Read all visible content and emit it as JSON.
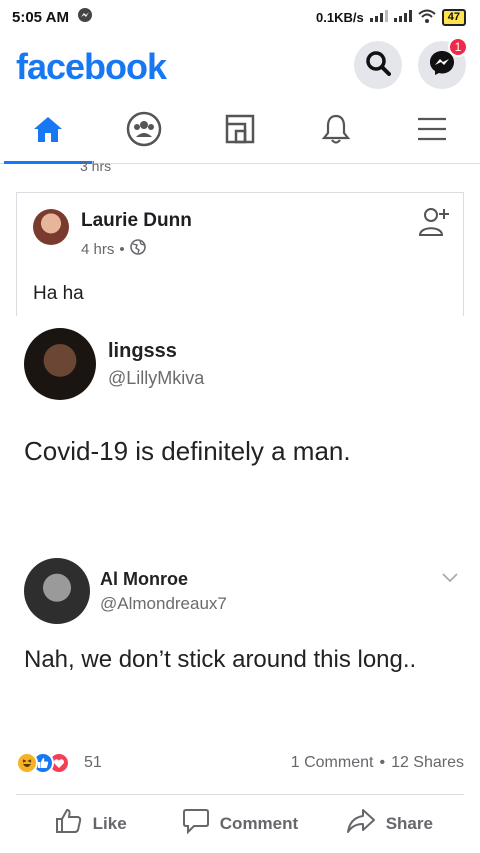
{
  "status": {
    "time": "5:05 AM",
    "speed": "0.1KB/s",
    "battery": "47"
  },
  "app": {
    "logo": "facebook",
    "messenger_badge": "1"
  },
  "nav": {
    "tabs": [
      "home-icon",
      "groups-icon",
      "marketplace-icon",
      "notifications-icon",
      "menu-icon"
    ],
    "active": "home-icon"
  },
  "peek_text": "3 hrs",
  "post": {
    "author": "Laurie Dunn",
    "time": "4 hrs",
    "text": "Ha ha",
    "tweet1": {
      "name": "lingsss",
      "handle": "@LillyMkiva",
      "text": "Covid-19 is definitely a man."
    },
    "tweet2": {
      "name": "Al Monroe",
      "handle": "@Almondreaux7",
      "text": "Nah, we don’t stick around this long.."
    },
    "reactions_count": "51",
    "comments": "1 Comment",
    "shares": "12 Shares",
    "actions": {
      "like": "Like",
      "comment": "Comment",
      "share": "Share"
    }
  },
  "colors": {
    "brand": "#1877f2",
    "badge": "#f02849"
  }
}
